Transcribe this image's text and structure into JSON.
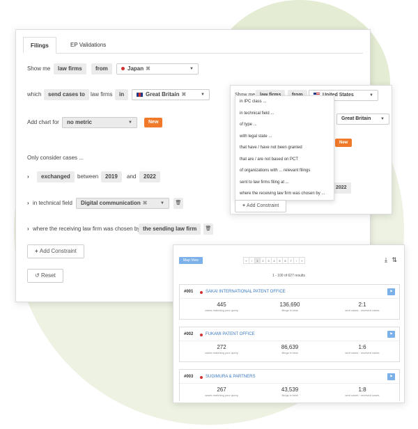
{
  "colors": {
    "accent_orange": "#f07a2a",
    "link_blue": "#3a78c2",
    "badge_blue": "#7bb1e8",
    "bg_green": "#edf2e2"
  },
  "main": {
    "tabs": [
      {
        "label": "Filings"
      },
      {
        "label": "EP Validations"
      }
    ],
    "row1": {
      "show_me": "Show me",
      "entity": "law firms",
      "from": "from",
      "country": "Japan",
      "remove": "✖"
    },
    "row2": {
      "which": "which",
      "action": "send cases to",
      "law_firms": "law firms",
      "in": "in",
      "country": "Great Britain",
      "remove": "✖"
    },
    "row3": {
      "label": "Add chart for",
      "metric": "no metric",
      "new_label": "New"
    },
    "only_consider": "Only consider cases ...",
    "row4": {
      "arrow": "›",
      "status": "exchanged",
      "between": "between",
      "year_from": "2019",
      "and": "and",
      "year_to": "2022"
    },
    "row5": {
      "arrow": "›",
      "label": "in technical field",
      "field": "Digital communication",
      "remove": "✖"
    },
    "row6": {
      "arrow": "›",
      "label": "where the receiving law firm was chosen by",
      "value": "the sending law firm"
    },
    "add_constraint": "Add Constraint",
    "reset": "Reset"
  },
  "dropdown": {
    "show_me": "Show me",
    "entity": "law firms",
    "from": "from",
    "country": "United States",
    "country2": "Great Britain",
    "new_label": "New",
    "year": "2022",
    "items": [
      "in IPC class ...",
      "in technical field ...",
      "of type ...",
      "with legal state ...",
      "that have / have not been granted",
      "that are / are not based on PCT",
      "of organizations with ... relevant filings",
      "sent to law firms filing at ...",
      "where the receiving law firm was chosen by ..."
    ],
    "add_constraint": "Add Constraint"
  },
  "results": {
    "map_view": "Map View",
    "pages": [
      "«",
      "‹",
      "1",
      "2",
      "3",
      "4",
      "5",
      "6",
      "7",
      "›",
      "»"
    ],
    "active_page": "1",
    "count_text": "1 - 100 of 627 results",
    "cards": [
      {
        "rank": "#001",
        "name": "SAKAI INTERNATIONAL PATENT OFFICE",
        "matching": "445",
        "matching_label": "cases matching your query",
        "filings": "136,690",
        "filings_label": "filings in total",
        "ratio": "2:1",
        "ratio_label": "sent cases : received cases"
      },
      {
        "rank": "#002",
        "name": "FUKAMI PATENT OFFICE",
        "matching": "272",
        "matching_label": "cases matching your query",
        "filings": "86,639",
        "filings_label": "filings in total",
        "ratio": "1:6",
        "ratio_label": "sent cases : received cases"
      },
      {
        "rank": "#003",
        "name": "SUGIMURA & PARTNERS",
        "matching": "267",
        "matching_label": "cases matching your query",
        "filings": "43,539",
        "filings_label": "filings in total",
        "ratio": "1:8",
        "ratio_label": "sent cases : received cases"
      }
    ]
  }
}
